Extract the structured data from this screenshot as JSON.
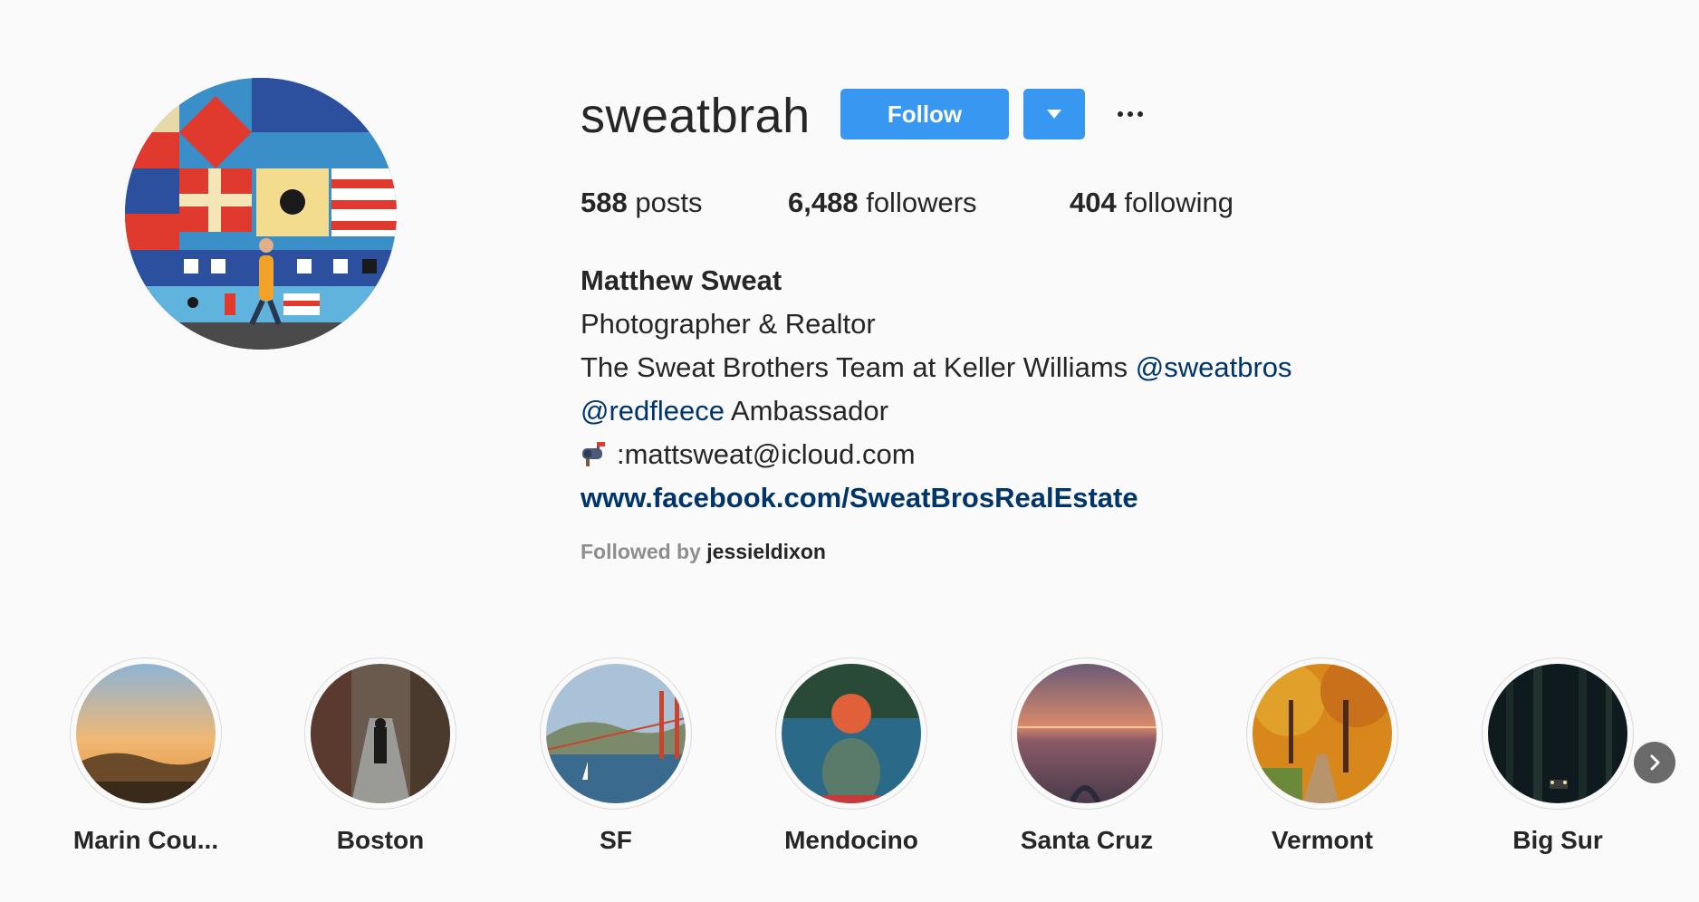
{
  "profile": {
    "username": "sweatbrah",
    "follow_label": "Follow",
    "posts_count": "588",
    "posts_label": "posts",
    "followers_count": "6,488",
    "followers_label": "followers",
    "following_count": "404",
    "following_label": "following"
  },
  "bio": {
    "full_name": "Matthew Sweat",
    "line1": "Photographer & Realtor",
    "line2_text": "The Sweat Brothers Team at Keller Williams ",
    "line2_mention": "@sweatbros",
    "line3_mention": "@redfleece",
    "line3_text": " Ambassador",
    "email_line": ":mattsweat@icloud.com",
    "website": "www.facebook.com/SweatBrosRealEstate"
  },
  "followed_by": {
    "prefix": "Followed by ",
    "user": "jessieldixon"
  },
  "highlights": [
    {
      "label": "Marin Cou..."
    },
    {
      "label": "Boston"
    },
    {
      "label": "SF"
    },
    {
      "label": "Mendocino"
    },
    {
      "label": "Santa Cruz"
    },
    {
      "label": "Vermont"
    },
    {
      "label": "Big Sur"
    }
  ],
  "colors": {
    "accent": "#3897f0",
    "link": "#003569",
    "background": "#fafafa",
    "muted": "#8e8e8e"
  },
  "icons": {
    "dropdown": "chevron-down-icon",
    "more": "more-options-icon",
    "mail": "mailbox-icon",
    "next": "chevron-right-icon"
  }
}
